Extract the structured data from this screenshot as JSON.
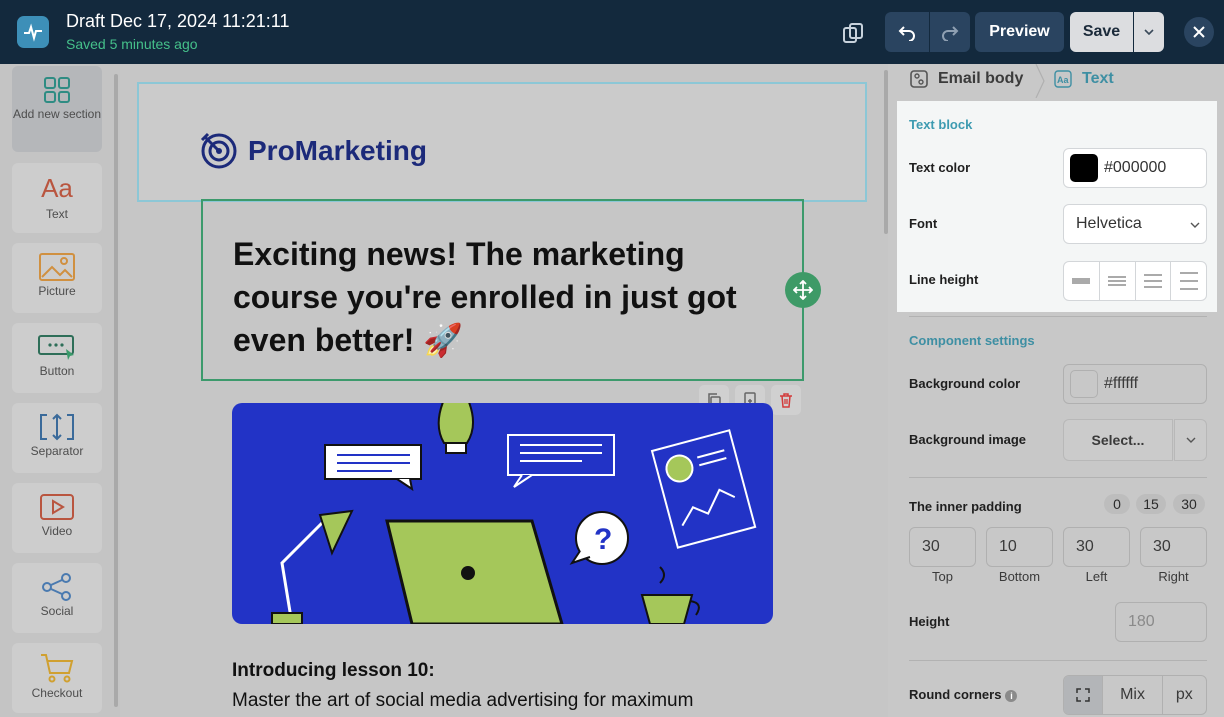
{
  "header": {
    "title": "Draft Dec 17, 2024 11:21:11",
    "saved_status": "Saved 5 minutes ago",
    "preview_label": "Preview",
    "save_label": "Save"
  },
  "sidebar": {
    "items": [
      {
        "label": "Add new section",
        "icon": "grid-icon"
      },
      {
        "label": "Text",
        "icon": "text-aa-icon"
      },
      {
        "label": "Picture",
        "icon": "picture-icon"
      },
      {
        "label": "Button",
        "icon": "button-icon"
      },
      {
        "label": "Separator",
        "icon": "separator-icon"
      },
      {
        "label": "Video",
        "icon": "video-icon"
      },
      {
        "label": "Social",
        "icon": "share-icon"
      },
      {
        "label": "Checkout",
        "icon": "cart-icon"
      }
    ]
  },
  "email": {
    "brand_name": "ProMarketing",
    "headline": "Exciting news! The marketing course you're enrolled in just got even better! 🚀",
    "lesson_title": "Introducing lesson 10:",
    "lesson_body": "Master the art of social media advertising for maximum"
  },
  "panel": {
    "breadcrumb_root": "Email body",
    "breadcrumb_current": "Text",
    "text_block_title": "Text block",
    "text_color_label": "Text color",
    "text_color_value": "#000000",
    "font_label": "Font",
    "font_value": "Helvetica",
    "line_height_label": "Line height",
    "component_settings_title": "Component settings",
    "bg_color_label": "Background color",
    "bg_color_value": "#ffffff",
    "bg_image_label": "Background image",
    "bg_image_select": "Select...",
    "inner_padding_label": "The inner padding",
    "padding_presets": [
      "0",
      "15",
      "30"
    ],
    "padding": [
      {
        "label": "Top",
        "value": "30"
      },
      {
        "label": "Bottom",
        "value": "10"
      },
      {
        "label": "Left",
        "value": "30"
      },
      {
        "label": "Right",
        "value": "30"
      }
    ],
    "height_label": "Height",
    "height_placeholder": "180",
    "round_corners_label": "Round corners",
    "round_corners_options": [
      "Mix",
      "px"
    ]
  },
  "colors": {
    "topbar": "#13293d",
    "accent_green": "#3c9a6c",
    "accent_teal": "#3d9bb1",
    "illustration_bg": "#2233c6"
  }
}
